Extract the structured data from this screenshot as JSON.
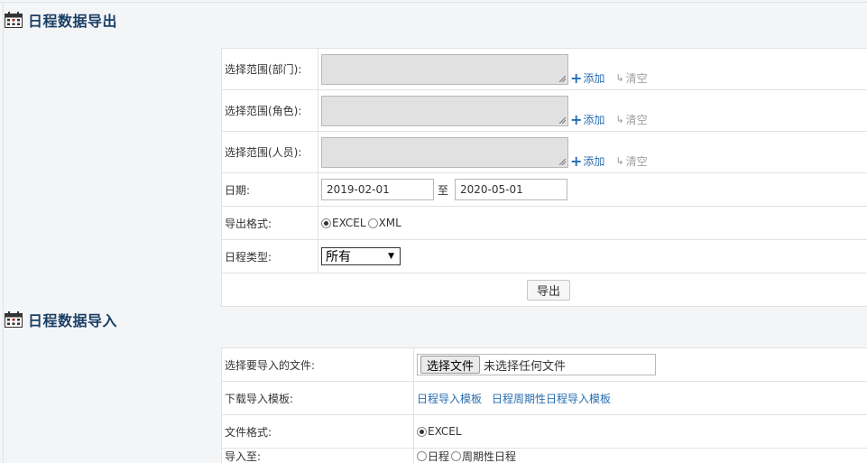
{
  "export_section": {
    "title": "日程数据导出",
    "scope_dept_label": "选择范围(部门):",
    "scope_role_label": "选择范围(角色):",
    "scope_person_label": "选择范围(人员):",
    "add_label": "添加",
    "clear_label": "清空",
    "date_label": "日期:",
    "date_start": "2019-02-01",
    "date_sep": "至",
    "date_end": "2020-05-01",
    "format_label": "导出格式:",
    "format_options": [
      "EXCEL",
      "XML"
    ],
    "format_selected": "EXCEL",
    "type_label": "日程类型:",
    "type_selected": "所有",
    "export_button": "导出"
  },
  "import_section": {
    "title": "日程数据导入",
    "file_label": "选择要导入的文件:",
    "file_button": "选择文件",
    "file_status": "未选择任何文件",
    "template_label": "下载导入模板:",
    "template_links": [
      "日程导入模板",
      "日程周期性日程导入模板"
    ],
    "format_label": "文件格式:",
    "format_option": "EXCEL",
    "import_to_label": "导入至:",
    "import_to_options": [
      "日程",
      "周期性日程"
    ]
  },
  "colors": {
    "title": "#1a3f66",
    "link": "#2a6db0",
    "border": "#e2e2e2",
    "background": "#f4f5f7"
  },
  "icons": {
    "section_icon": "calendar-icon",
    "add": "plus-icon",
    "clear": "clear-arrow-icon"
  }
}
